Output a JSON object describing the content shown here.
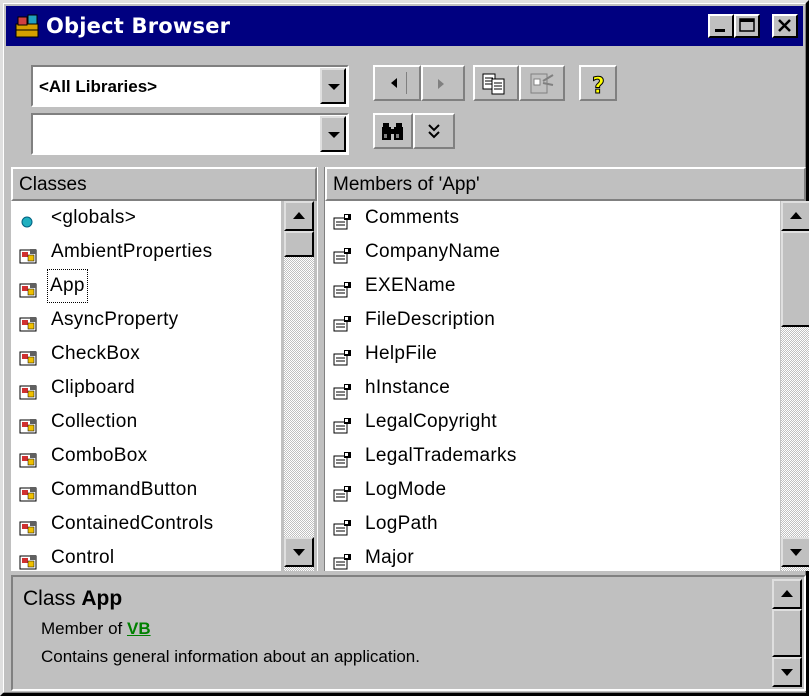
{
  "window": {
    "title": "Object Browser"
  },
  "toolbar": {
    "library_combo_value": "<All Libraries>",
    "search_combo_value": ""
  },
  "classes": {
    "header": "Classes",
    "items": [
      {
        "label": "<globals>",
        "icon": "globals-icon"
      },
      {
        "label": "AmbientProperties",
        "icon": "class-icon"
      },
      {
        "label": "App",
        "icon": "class-icon",
        "selected": true
      },
      {
        "label": "AsyncProperty",
        "icon": "class-icon"
      },
      {
        "label": "CheckBox",
        "icon": "class-icon"
      },
      {
        "label": "Clipboard",
        "icon": "class-icon"
      },
      {
        "label": "Collection",
        "icon": "class-icon"
      },
      {
        "label": "ComboBox",
        "icon": "class-icon"
      },
      {
        "label": "CommandButton",
        "icon": "class-icon"
      },
      {
        "label": "ContainedControls",
        "icon": "class-icon"
      },
      {
        "label": "Control",
        "icon": "class-icon"
      }
    ]
  },
  "members": {
    "header": "Members of 'App'",
    "items": [
      {
        "label": "Comments",
        "icon": "property-icon"
      },
      {
        "label": "CompanyName",
        "icon": "property-icon"
      },
      {
        "label": "EXEName",
        "icon": "property-icon"
      },
      {
        "label": "FileDescription",
        "icon": "property-icon"
      },
      {
        "label": "HelpFile",
        "icon": "property-icon"
      },
      {
        "label": "hInstance",
        "icon": "property-icon"
      },
      {
        "label": "LegalCopyright",
        "icon": "property-icon"
      },
      {
        "label": "LegalTrademarks",
        "icon": "property-icon"
      },
      {
        "label": "LogMode",
        "icon": "property-icon"
      },
      {
        "label": "LogPath",
        "icon": "property-icon"
      },
      {
        "label": "Major",
        "icon": "property-icon"
      }
    ]
  },
  "info": {
    "kind": "Class",
    "name": "App",
    "member_of_prefix": "Member of",
    "member_of_link": "VB",
    "description": "Contains general information about an application."
  },
  "colors": {
    "titlebar": "#000080",
    "face": "#c0c0c0",
    "link": "#008000"
  }
}
